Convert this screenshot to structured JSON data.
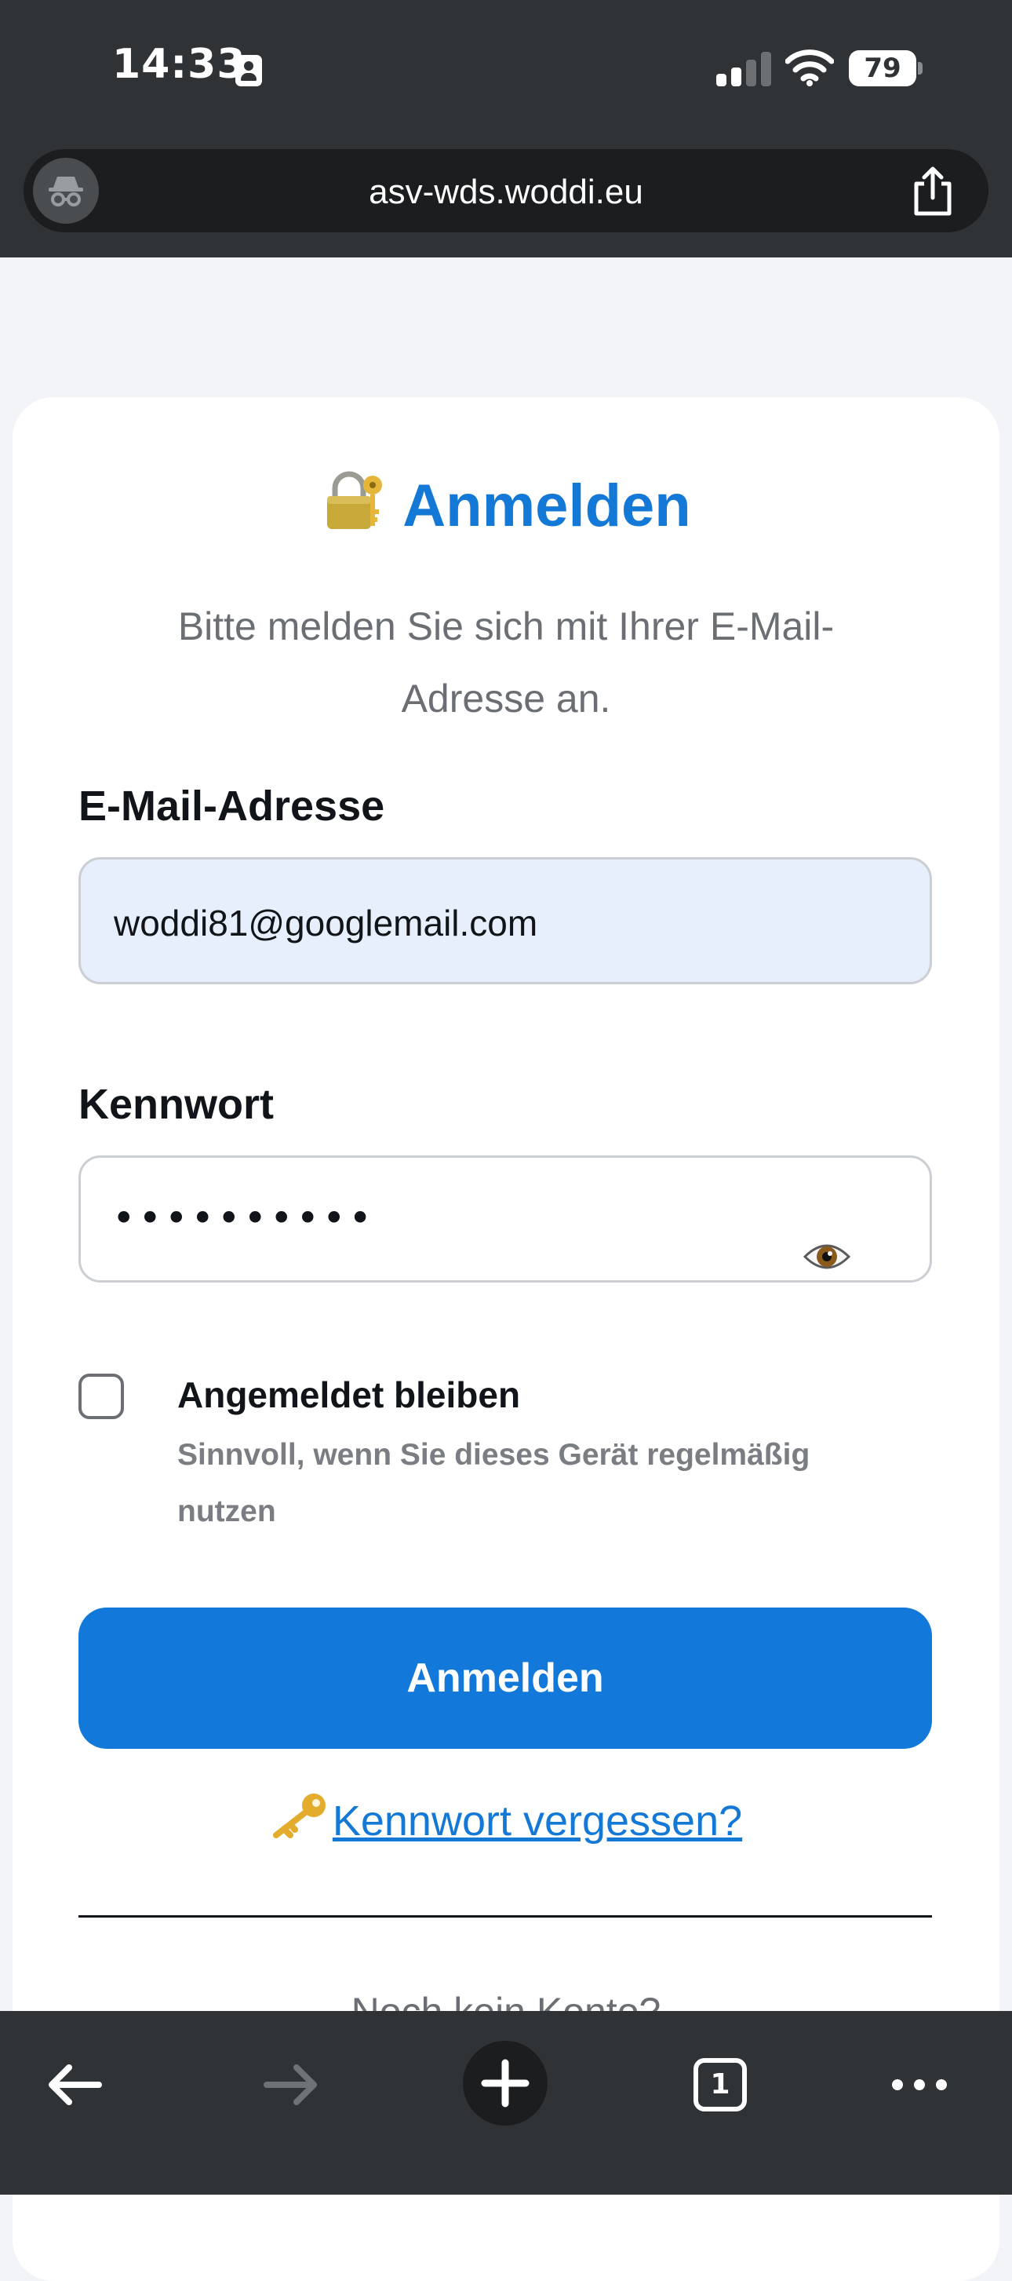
{
  "status_bar": {
    "time": "14:33",
    "battery": "79"
  },
  "browser": {
    "url": "asv-wds.woddi.eu",
    "tab_count": "1"
  },
  "login": {
    "title": "Anmelden",
    "subtitle": "Bitte melden Sie sich mit Ihrer E-Mail-Adresse an.",
    "email_label": "E-Mail-Adresse",
    "email_value": "woddi81@googlemail.com",
    "password_label": "Kennwort",
    "password_masked": "••••••••••",
    "remember_label": "Angemeldet bleiben",
    "remember_hint": "Sinnvoll, wenn Sie dieses Gerät regelmäßig nutzen",
    "remember_checked": false,
    "submit_label": "Anmelden",
    "forgot_link": "Kennwort vergessen?",
    "no_account": "Noch kein Konto?"
  },
  "colors": {
    "accent": "#1479d6",
    "button": "#1279db",
    "chrome": "#303336",
    "email_field_bg": "#e8effc"
  },
  "icons": [
    "contact-card-icon",
    "signal-icon",
    "wifi-icon",
    "battery-icon",
    "incognito-icon",
    "share-icon",
    "lock-with-key-icon",
    "eye-icon",
    "key-icon",
    "back-arrow-icon",
    "forward-arrow-icon",
    "plus-icon",
    "tabs-icon",
    "more-dots-icon"
  ]
}
